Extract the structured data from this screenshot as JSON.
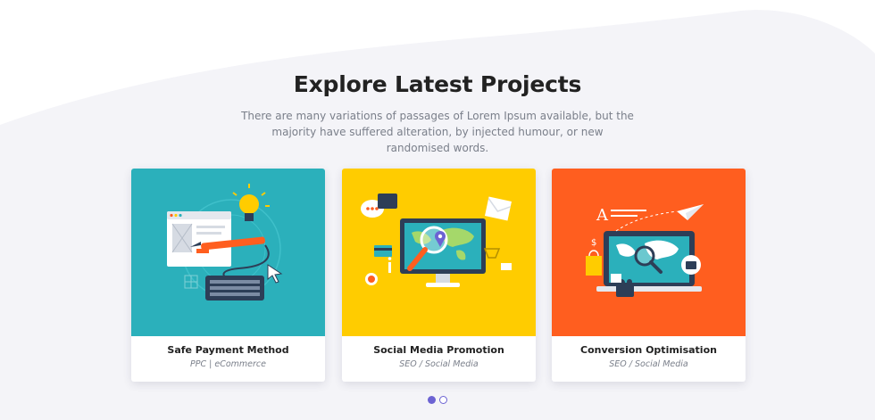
{
  "section": {
    "title": "Explore Latest Projects",
    "subtitle": "There are many variations of passages of Lorem Ipsum available, but the majority have suffered alteration, by injected humour, or new randomised words."
  },
  "projects": [
    {
      "title": "Safe Payment Method",
      "tags": "PPC | eCommerce",
      "bg_color": "#2bb0bb"
    },
    {
      "title": "Social Media Promotion",
      "tags": "SEO / Social Media",
      "bg_color": "#ffcc00"
    },
    {
      "title": "Conversion Optimisation",
      "tags": "SEO / Social Media",
      "bg_color": "#ff5e1f"
    }
  ],
  "pagination": {
    "active_index": 0,
    "count": 2,
    "accent": "#6c63d3"
  },
  "colors": {
    "background_wave": "#f4f4f8",
    "title": "#222222",
    "muted": "#7a7f8a"
  }
}
